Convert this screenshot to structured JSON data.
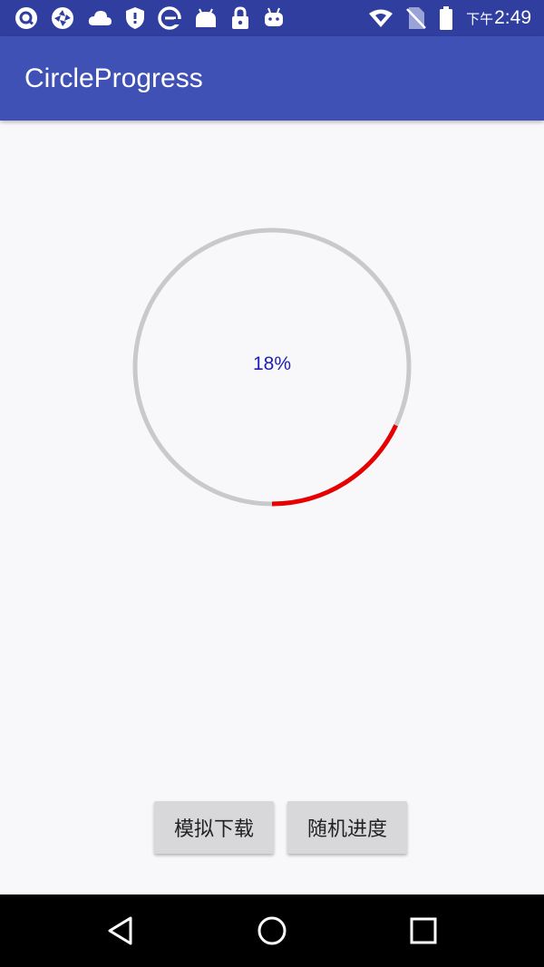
{
  "status_bar": {
    "ampm": "下午",
    "time": "2:49",
    "left_icons": [
      "q-app-icon",
      "aperture-app-icon",
      "cloud-icon",
      "shield-icon",
      "browser-e-icon",
      "android-icon",
      "lock-icon",
      "robot-icon"
    ],
    "right_icons": [
      "wifi-icon",
      "no-sim-icon",
      "battery-icon"
    ]
  },
  "app_bar": {
    "title": "CircleProgress"
  },
  "progress": {
    "value": 0.18,
    "label": "18%",
    "start_angle_deg": 90,
    "colors": {
      "track": "#c9c8cb",
      "fill": "#e60000",
      "text": "#1f1fb0"
    }
  },
  "buttons": {
    "simulate_download": "模拟下载",
    "random_progress": "随机进度"
  },
  "nav_bar": {
    "icons": [
      "back-icon",
      "home-icon",
      "recents-icon"
    ]
  },
  "colors": {
    "status_bar": "#303f9f",
    "app_bar": "#3f51b5",
    "background": "#f8f7fa"
  }
}
